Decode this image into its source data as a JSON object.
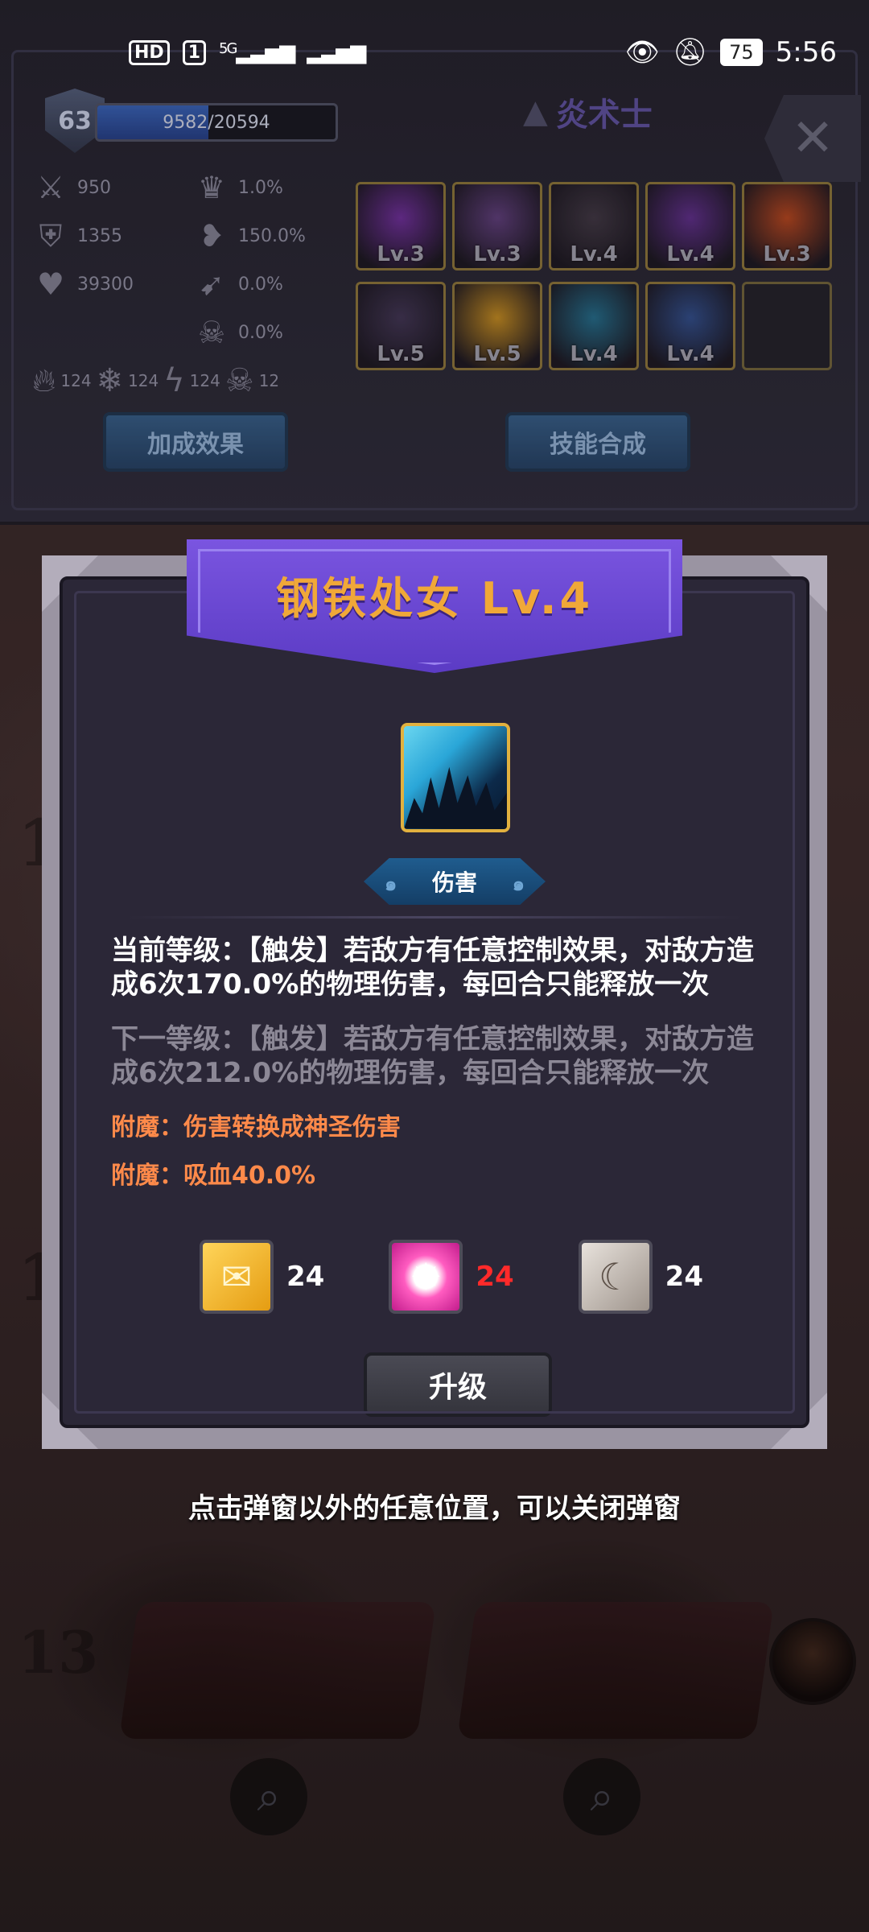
{
  "status_bar": {
    "hd_label": "HD",
    "sim_label": "1",
    "net_label": "5G",
    "signal_icon": "signal-bars",
    "battery": "75",
    "time": "5:56"
  },
  "character": {
    "level": "63",
    "exp_text": "9582/20594",
    "exp_fraction": 0.465,
    "class_name": "炎术士",
    "stats": [
      {
        "icon": "sword-icon",
        "value": "950"
      },
      {
        "icon": "shield-icon",
        "value": "1355"
      },
      {
        "icon": "heart-icon",
        "value": "39300"
      },
      {
        "icon": "crown-icon",
        "value": "1.0%"
      },
      {
        "icon": "heart-break-icon",
        "value": "150.0%"
      },
      {
        "icon": "arrow-icon",
        "value": "0.0%"
      },
      {
        "icon": "skull-icon",
        "value": "0.0%"
      }
    ],
    "elements": [
      {
        "icon": "fire-icon",
        "value": "124"
      },
      {
        "icon": "snowflake-icon",
        "value": "124"
      },
      {
        "icon": "lightning-icon",
        "value": "124"
      },
      {
        "icon": "poison-skull-icon",
        "value": "12"
      }
    ],
    "buttons": {
      "bonus": "加成效果",
      "synthesis": "技能合成"
    },
    "skills": [
      {
        "lv": "Lv.3",
        "color": "#6a2a9a"
      },
      {
        "lv": "Lv.3",
        "color": "#5a3a7a"
      },
      {
        "lv": "Lv.4",
        "color": "#3a3340"
      },
      {
        "lv": "Lv.4",
        "color": "#5a2a8a"
      },
      {
        "lv": "Lv.3",
        "color": "#b4421a"
      },
      {
        "lv": "Lv.5",
        "color": "#3a3050"
      },
      {
        "lv": "Lv.5",
        "color": "#c28a1c"
      },
      {
        "lv": "Lv.4",
        "color": "#1c6a8a"
      },
      {
        "lv": "Lv.4",
        "color": "#2a4a8a"
      },
      {
        "lv": "",
        "color": "#1b1c24"
      }
    ]
  },
  "popup": {
    "title": "钢铁处女 Lv.4",
    "tag": "伤害",
    "current": "当前等级：【触发】若敌方有任意控制效果，对敌方造成6次170.0%的物理伤害，每回合只能释放一次",
    "next": "下一等级：【触发】若敌方有任意控制效果，对敌方造成6次212.0%的物理伤害，每回合只能释放一次",
    "enchant1": "附魔：伤害转换成神圣伤害",
    "enchant2": "附魔：吸血40.0%",
    "costs": [
      {
        "gem": "gold",
        "value": "24",
        "color": "#ffffff"
      },
      {
        "gem": "pink",
        "value": "24",
        "color": "#ff2a2a"
      },
      {
        "gem": "white",
        "value": "24",
        "color": "#ffffff"
      }
    ],
    "upgrade_label": "升级"
  },
  "hint": "点击弹窗以外的任意位置，可以关闭弹窗",
  "background": {
    "numbers": [
      "1",
      "1",
      "13"
    ]
  }
}
